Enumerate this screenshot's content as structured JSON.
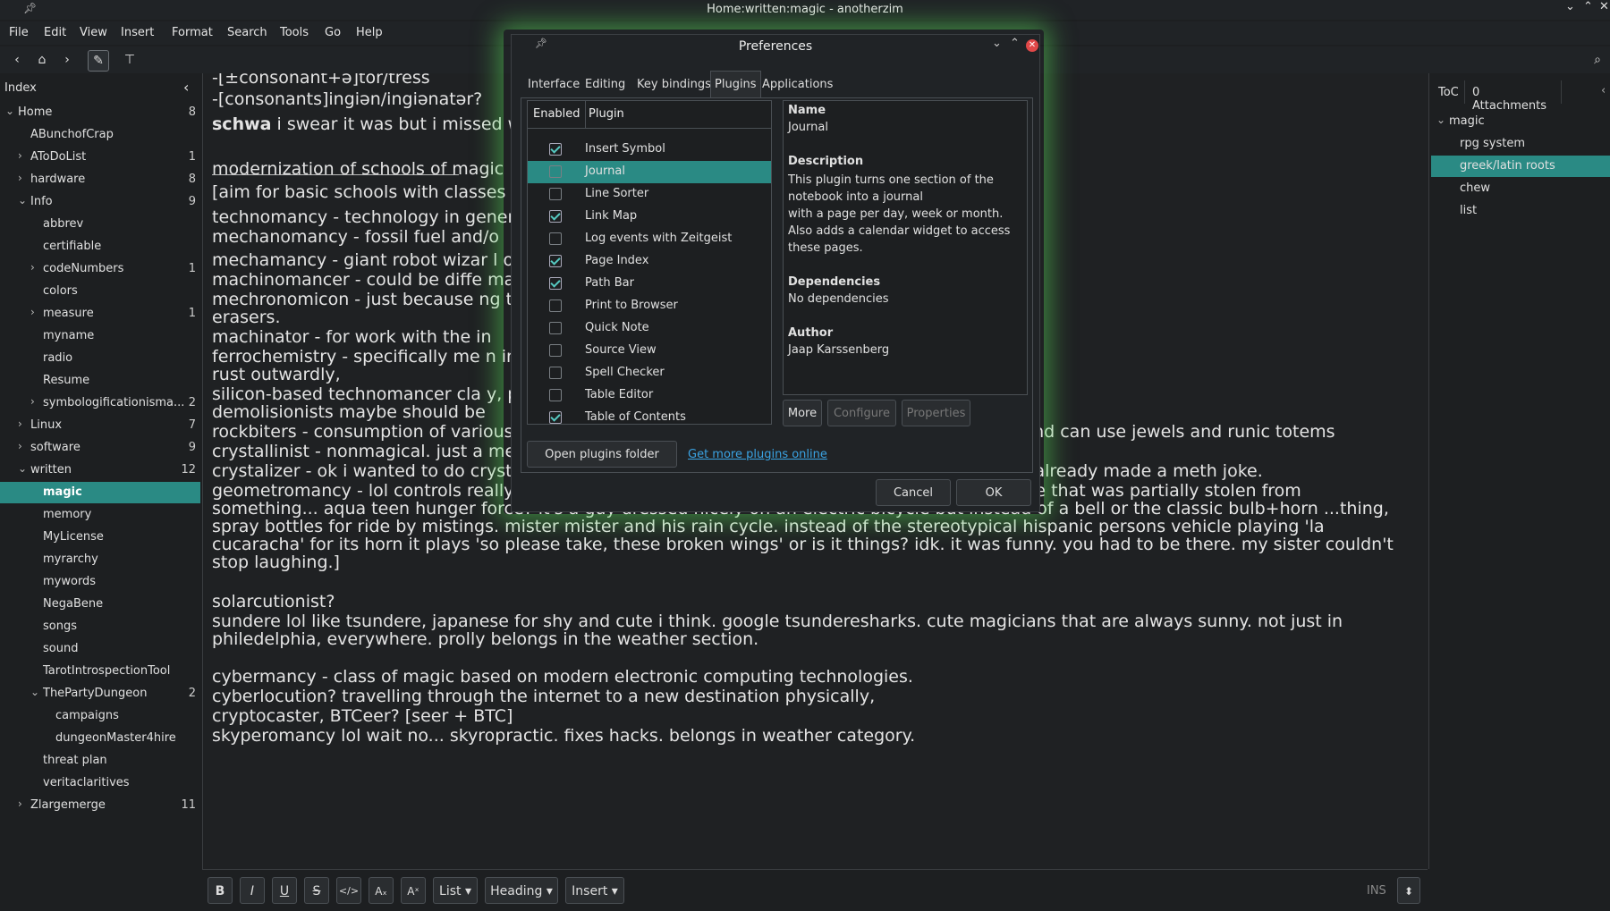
{
  "window": {
    "title": "Home:written:magic - anotherzim"
  },
  "menu": [
    "File",
    "Edit",
    "View",
    "Insert",
    "Format",
    "Search",
    "Tools",
    "Go",
    "Help"
  ],
  "index": {
    "title": "Index",
    "items": [
      {
        "label": "Home",
        "count": "8",
        "level": 0,
        "expanded": true
      },
      {
        "label": "ABunchofCrap",
        "count": "",
        "level": 1,
        "expanded": null
      },
      {
        "label": "AToDoList",
        "count": "1",
        "level": 1,
        "expanded": false
      },
      {
        "label": "hardware",
        "count": "8",
        "level": 1,
        "expanded": false
      },
      {
        "label": "Info",
        "count": "9",
        "level": 1,
        "expanded": true
      },
      {
        "label": "abbrev",
        "count": "",
        "level": 2,
        "expanded": null
      },
      {
        "label": "certifiable",
        "count": "",
        "level": 2,
        "expanded": null
      },
      {
        "label": "codeNumbers",
        "count": "1",
        "level": 2,
        "expanded": false
      },
      {
        "label": "colors",
        "count": "",
        "level": 2,
        "expanded": null
      },
      {
        "label": "measure",
        "count": "1",
        "level": 2,
        "expanded": false
      },
      {
        "label": "myname",
        "count": "",
        "level": 2,
        "expanded": null
      },
      {
        "label": "radio",
        "count": "",
        "level": 2,
        "expanded": null
      },
      {
        "label": "Resume",
        "count": "",
        "level": 2,
        "expanded": null
      },
      {
        "label": "symbologificationisma...",
        "count": "2",
        "level": 2,
        "expanded": false
      },
      {
        "label": "Linux",
        "count": "7",
        "level": 1,
        "expanded": false
      },
      {
        "label": "software",
        "count": "9",
        "level": 1,
        "expanded": false
      },
      {
        "label": "written",
        "count": "12",
        "level": 1,
        "expanded": true
      },
      {
        "label": "magic",
        "count": "",
        "level": 2,
        "expanded": null,
        "selected": true
      },
      {
        "label": "memory",
        "count": "",
        "level": 2,
        "expanded": null
      },
      {
        "label": "MyLicense",
        "count": "",
        "level": 2,
        "expanded": null
      },
      {
        "label": "myrarchy",
        "count": "",
        "level": 2,
        "expanded": null
      },
      {
        "label": "mywords",
        "count": "",
        "level": 2,
        "expanded": null
      },
      {
        "label": "NegaBene",
        "count": "",
        "level": 2,
        "expanded": null
      },
      {
        "label": "songs",
        "count": "",
        "level": 2,
        "expanded": null
      },
      {
        "label": "sound",
        "count": "",
        "level": 2,
        "expanded": null
      },
      {
        "label": "TarotIntrospectionTool",
        "count": "",
        "level": 2,
        "expanded": null
      },
      {
        "label": "ThePartyDungeon",
        "count": "2",
        "level": 2,
        "expanded": true
      },
      {
        "label": "campaigns",
        "count": "",
        "level": 3,
        "expanded": null
      },
      {
        "label": "dungeonMaster4hire",
        "count": "",
        "level": 3,
        "expanded": null
      },
      {
        "label": "threat plan",
        "count": "",
        "level": 2,
        "expanded": null
      },
      {
        "label": "veritaclaritives",
        "count": "",
        "level": 2,
        "expanded": null
      },
      {
        "label": "Zlargemerge",
        "count": "11",
        "level": 1,
        "expanded": false
      }
    ]
  },
  "editor": {
    "lines": [
      "-[±consonant+ə]tor/tress",
      "-[consonants]ingiən/ingiənatər?",
      "schwa i swear it was but i missed w",
      "",
      "modernization of schools of magic",
      "[aim for basic schools with classes                                                                                                                                              upside down. kinda... almost?)]",
      "technomancy - technology in gener                                                                                                                                              e tools are technology.",
      "  mechanomancy - fossil fuel and/o",
      "    mechamancy - giant robot wizar                                                                                                                                               l one with angels that i forget the name of.]",
      "    machinomancer - could be diffe                                                                                                                                               magic, repair based mechanics,",
      "    mechronomicon - just because                                                                                                                                                 ng textbook. made out of pencils without",
      "    erasers.",
      "    machinator - for work with the in",
      "    ferrochemistry - specifically me                                                                                                                                               n increases, hardened skin/armor/weaponry,",
      "    rust outwardly,",
      "    silicon-based technomancer cla                                                                                                                                                y, potassium/cesium explosives/",
      "    demolisionists maybe should be",
      "    rockbiters - consumption of various elements gives various temporary traits. often gemcutters and can use jewels and runic totems",
      "    crystallinist - nonmagical. just a meth addict who loves authoritarian rule.",
      "    crystalizer - ok i wanted to do crystal + wizard but that sounds too much like crystal lizard and i already made a meth joke.",
      "    geometromancy - lol controls really tiny but fuel efficient cars. see economistermister [inside joke that was partially stolen from",
      "    something... aqua teen hunger force? it's a guy dressed nicely on an electric bicycle but instead of a bell or the classic bulb+horn ...thing,",
      "    spray bottles for ride by mistings. mister mister and his rain cycle. instead of the stereotypical hispanic persons vehicle playing 'la",
      "    cucaracha' for its horn it plays 'so please take, these broken wings' or is it things? idk. it was funny. you had to be there. my sister couldn't",
      "    stop laughing.]",
      "solarcutionist?",
      "    sundere lol like tsundere, japanese for shy and cute i think. google tsunderesharks. cute magicians that are always sunny. not just in",
      "    philedelphia, everywhere. prolly belongs in the weather section.",
      "cybermancy - class of magic based on modern electronic computing technologies.",
      "  cyberlocution? travelling through the internet to a new destination physically,",
      "     cryptocaster, BTCeer? [seer + BTC]",
      "     skyperomancy lol wait no... skyropractic. fixes hacks. belongs in weather category."
    ]
  },
  "right_panel": {
    "tabs": [
      "ToC",
      "0 Attachments"
    ],
    "toc": [
      {
        "label": "magic",
        "level": 0
      },
      {
        "label": "rpg system",
        "level": 1
      },
      {
        "label": "greek/latin roots",
        "level": 1,
        "selected": true
      },
      {
        "label": "chew",
        "level": 1
      },
      {
        "label": "list",
        "level": 1
      }
    ]
  },
  "format_bar": {
    "list_label": "List",
    "heading_label": "Heading",
    "insert_label": "Insert",
    "mode": "INS"
  },
  "dialog": {
    "title": "Preferences",
    "tabs": [
      "Interface",
      "Editing",
      "Key bindings",
      "Plugins",
      "Applications"
    ],
    "active_tab": "Plugins",
    "columns": {
      "enabled": "Enabled",
      "plugin": "Plugin"
    },
    "plugins": [
      {
        "name": "Insert Symbol",
        "enabled": true
      },
      {
        "name": "Journal",
        "enabled": false,
        "selected": true
      },
      {
        "name": "Line Sorter",
        "enabled": false
      },
      {
        "name": "Link Map",
        "enabled": true
      },
      {
        "name": "Log events with Zeitgeist",
        "enabled": false
      },
      {
        "name": "Page Index",
        "enabled": true
      },
      {
        "name": "Path Bar",
        "enabled": true
      },
      {
        "name": "Print to Browser",
        "enabled": false
      },
      {
        "name": "Quick Note",
        "enabled": false
      },
      {
        "name": "Source View",
        "enabled": false
      },
      {
        "name": "Spell Checker",
        "enabled": false
      },
      {
        "name": "Table Editor",
        "enabled": false
      },
      {
        "name": "Table of Contents",
        "enabled": true
      }
    ],
    "info": {
      "name_label": "Name",
      "name": "Journal",
      "desc_label": "Description",
      "desc_lines": [
        "This plugin turns one section of the",
        "notebook into a journal",
        "with a page per day, week or month.",
        "Also adds a calendar widget to access",
        "these pages."
      ],
      "deps_label": "Dependencies",
      "deps": "No dependencies",
      "author_label": "Author",
      "author": "Jaap Karssenberg"
    },
    "buttons": {
      "more": "More",
      "configure": "Configure",
      "properties": "Properties",
      "open_folder": "Open plugins folder",
      "get_more": "Get more plugins online",
      "cancel": "Cancel",
      "ok": "OK"
    }
  },
  "colors": {
    "accent": "#2a8a84",
    "glow": "#5adc5a",
    "link": "#3aa3e3"
  }
}
